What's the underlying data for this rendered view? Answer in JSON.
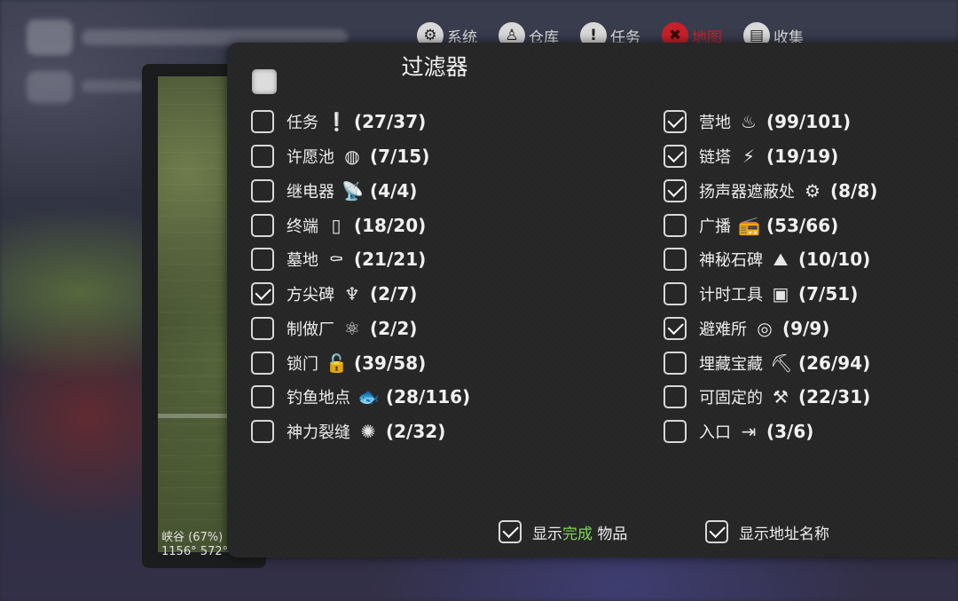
{
  "menu": [
    {
      "label": "系统",
      "icon": "gear-icon",
      "glyph": "⚙",
      "active": false
    },
    {
      "label": "仓库",
      "icon": "person-icon",
      "glyph": "♙",
      "active": false
    },
    {
      "label": "任务",
      "icon": "exclamation-icon",
      "glyph": "!",
      "active": false
    },
    {
      "label": "地图",
      "icon": "map-icon",
      "glyph": "✖",
      "active": true
    },
    {
      "label": "收集",
      "icon": "collection-icon",
      "glyph": "▤",
      "active": false
    }
  ],
  "map": {
    "coords_line1": "峡谷 (67%)",
    "coords_line2": "1156° 572°"
  },
  "panel": {
    "title": "过滤器"
  },
  "filters_left": [
    {
      "label": "任务",
      "icon": "exclamation-icon",
      "glyph": "❕",
      "count": "(27/37)",
      "checked": false
    },
    {
      "label": "许愿池",
      "icon": "wishing-well-icon",
      "glyph": "◍",
      "count": "(7/15)",
      "checked": false
    },
    {
      "label": "继电器",
      "icon": "satellite-dish-icon",
      "glyph": "📡",
      "count": "(4/4)",
      "checked": false
    },
    {
      "label": "终端",
      "icon": "terminal-icon",
      "glyph": "▯",
      "count": "(18/20)",
      "checked": false
    },
    {
      "label": "墓地",
      "icon": "graveyard-icon",
      "glyph": "⚰",
      "count": "(21/21)",
      "checked": false
    },
    {
      "label": "方尖碑",
      "icon": "obelisk-icon",
      "glyph": "♆",
      "count": "(2/7)",
      "checked": true
    },
    {
      "label": "制做厂",
      "icon": "atom-icon",
      "glyph": "⚛",
      "count": "(2/2)",
      "checked": false
    },
    {
      "label": "锁门",
      "icon": "lock-icon",
      "glyph": "🔓",
      "count": "(39/58)",
      "checked": false
    },
    {
      "label": "钓鱼地点",
      "icon": "fish-icon",
      "glyph": "🐟",
      "count": "(28/116)",
      "checked": false
    },
    {
      "label": "神力裂缝",
      "icon": "rift-gear-icon",
      "glyph": "✺",
      "count": "(2/32)",
      "checked": false
    }
  ],
  "filters_right": [
    {
      "label": "营地",
      "icon": "campfire-icon",
      "glyph": "♨",
      "count": "(99/101)",
      "checked": true
    },
    {
      "label": "链塔",
      "icon": "radio-tower-icon",
      "glyph": "⚡",
      "count": "(19/19)",
      "checked": true
    },
    {
      "label": "扬声器遮蔽处",
      "icon": "speaker-icon",
      "glyph": "⚙",
      "count": "(8/8)",
      "checked": true
    },
    {
      "label": "广播",
      "icon": "radio-icon",
      "glyph": "📻",
      "count": "(53/66)",
      "checked": false
    },
    {
      "label": "神秘石碑",
      "icon": "stone-tablet-icon",
      "glyph": "⛰",
      "count": "(10/10)",
      "checked": false
    },
    {
      "label": "计时工具",
      "icon": "timer-icon",
      "glyph": "▣",
      "count": "(7/51)",
      "checked": false
    },
    {
      "label": "避难所",
      "icon": "shelter-icon",
      "glyph": "◎",
      "count": "(9/9)",
      "checked": true
    },
    {
      "label": "埋藏宝藏",
      "icon": "shovel-icon",
      "glyph": "⛏",
      "count": "(26/94)",
      "checked": false
    },
    {
      "label": "可固定的",
      "icon": "tools-icon",
      "glyph": "⚒",
      "count": "(22/31)",
      "checked": false
    },
    {
      "label": "入口",
      "icon": "entrance-icon",
      "glyph": "⇥",
      "count": "(3/6)",
      "checked": false
    }
  ],
  "bottom": {
    "show_completed": {
      "prefix": "显示",
      "highlight": "完成",
      "suffix": " 物品",
      "checked": true
    },
    "show_address": {
      "label": "显示地址名称",
      "checked": true
    }
  },
  "colors": {
    "accent_active": "#c8202a",
    "highlight_green": "#7ed957",
    "panel_bg": "#262626"
  }
}
